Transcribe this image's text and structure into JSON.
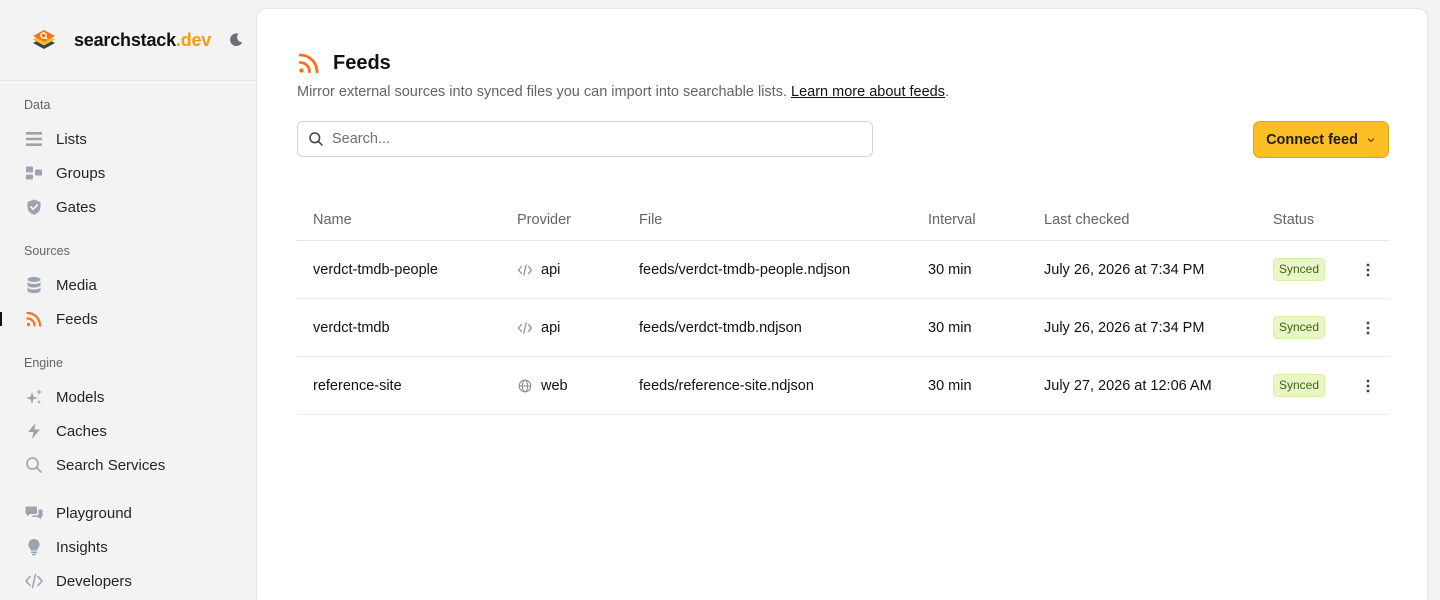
{
  "brand": {
    "name": "searchstack",
    "tld": ".dev"
  },
  "sidebar": {
    "sections": {
      "data": "Data",
      "sources": "Sources",
      "engine": "Engine"
    },
    "items": {
      "lists": "Lists",
      "groups": "Groups",
      "gates": "Gates",
      "media": "Media",
      "feeds": "Feeds",
      "models": "Models",
      "caches": "Caches",
      "search_services": "Search Services",
      "playground": "Playground",
      "insights": "Insights",
      "developers": "Developers"
    },
    "active": "feeds"
  },
  "page": {
    "title": "Feeds",
    "description": "Mirror external sources into synced files you can import into searchable lists.",
    "learn_more": "Learn more about feeds",
    "period": "."
  },
  "search": {
    "placeholder": "Search...",
    "value": ""
  },
  "connect_button": "Connect feed",
  "table": {
    "columns": {
      "name": "Name",
      "provider": "Provider",
      "file": "File",
      "interval": "Interval",
      "last_checked": "Last checked",
      "status": "Status"
    },
    "rows": [
      {
        "name": "verdct-tmdb-people",
        "provider": "api",
        "provider_icon": "code-icon",
        "file": "feeds/verdct-tmdb-people.ndjson",
        "interval": "30 min",
        "last_checked": "July 26, 2026 at 7:34 PM",
        "status": "Synced"
      },
      {
        "name": "verdct-tmdb",
        "provider": "api",
        "provider_icon": "code-icon",
        "file": "feeds/verdct-tmdb.ndjson",
        "interval": "30 min",
        "last_checked": "July 26, 2026 at 7:34 PM",
        "status": "Synced"
      },
      {
        "name": "reference-site",
        "provider": "web",
        "provider_icon": "globe-icon",
        "file": "feeds/reference-site.ndjson",
        "interval": "30 min",
        "last_checked": "July 27, 2026 at 12:06 AM",
        "status": "Synced"
      }
    ]
  },
  "colors": {
    "accent": "#f97316",
    "button": "#fbbf24",
    "badge_bg": "#e9f7c8",
    "badge_text": "#3f6212"
  }
}
